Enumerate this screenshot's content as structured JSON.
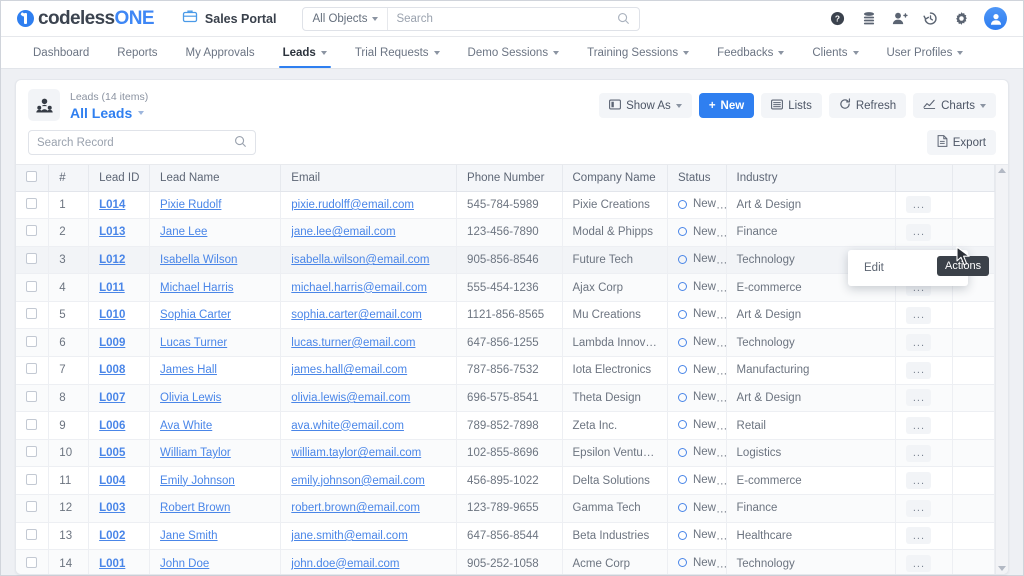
{
  "header": {
    "logo": {
      "part1": "codeless",
      "part2": "ONE",
      "icon": "codelessone-logo-icon"
    },
    "portal": {
      "label": "Sales Portal",
      "icon": "briefcase-icon"
    },
    "global_search": {
      "object_filter": "All Objects",
      "placeholder": "Search",
      "value": "",
      "icon": "search-icon"
    },
    "icons": [
      {
        "name": "help-icon",
        "glyph": "?"
      },
      {
        "name": "database-icon",
        "glyph": ""
      },
      {
        "name": "add-user-icon",
        "glyph": ""
      },
      {
        "name": "history-icon",
        "glyph": ""
      },
      {
        "name": "gear-icon",
        "glyph": ""
      },
      {
        "name": "user-avatar",
        "glyph": ""
      }
    ]
  },
  "nav": {
    "items": [
      {
        "label": "Dashboard",
        "has_caret": false,
        "active": false
      },
      {
        "label": "Reports",
        "has_caret": false,
        "active": false
      },
      {
        "label": "My Approvals",
        "has_caret": false,
        "active": false
      },
      {
        "label": "Leads",
        "has_caret": true,
        "active": true
      },
      {
        "label": "Trial Requests",
        "has_caret": true,
        "active": false
      },
      {
        "label": "Demo Sessions",
        "has_caret": true,
        "active": false
      },
      {
        "label": "Training Sessions",
        "has_caret": true,
        "active": false
      },
      {
        "label": "Feedbacks",
        "has_caret": true,
        "active": false
      },
      {
        "label": "Clients",
        "has_caret": true,
        "active": false
      },
      {
        "label": "User Profiles",
        "has_caret": true,
        "active": false
      }
    ]
  },
  "list_header": {
    "object_icon": "leads-person-icon",
    "subtitle": "Leads (14 items)",
    "title": "All Leads",
    "search_record": {
      "placeholder": "Search Record",
      "value": "",
      "icon": "search-icon"
    },
    "buttons": [
      {
        "label": "Show As",
        "icon": "layout-icon",
        "caret": true,
        "primary": false
      },
      {
        "label": "New",
        "icon": "plus-icon",
        "caret": false,
        "primary": true
      },
      {
        "label": "Lists",
        "icon": "list-icon",
        "caret": false,
        "primary": false
      },
      {
        "label": "Refresh",
        "icon": "refresh-icon",
        "caret": false,
        "primary": false
      },
      {
        "label": "Charts",
        "icon": "chart-icon",
        "caret": true,
        "primary": false
      }
    ],
    "export": {
      "label": "Export",
      "icon": "export-file-icon"
    }
  },
  "table": {
    "columns": [
      "",
      "#",
      "Lead ID",
      "Lead Name",
      "Email",
      "Phone Number",
      "Company Name",
      "Status",
      "Industry",
      "",
      ""
    ],
    "row_action_label": "...",
    "rows": [
      {
        "num": "1",
        "id": "L014",
        "name": "Pixie Rudolf",
        "email": "pixie.rudolff@email.com",
        "phone": "545-784-5989",
        "company": "Pixie Creations",
        "status": "New",
        "industry": "Art & Design"
      },
      {
        "num": "2",
        "id": "L013",
        "name": "Jane Lee",
        "email": "jane.lee@email.com",
        "phone": "123-456-7890",
        "company": "Modal & Phipps",
        "status": "New",
        "industry": "Finance"
      },
      {
        "num": "3",
        "id": "L012",
        "name": "Isabella Wilson",
        "email": "isabella.wilson@email.com",
        "phone": "905-856-8546",
        "company": "Future Tech",
        "status": "New",
        "industry": "Technology"
      },
      {
        "num": "4",
        "id": "L011",
        "name": "Michael Harris",
        "email": "michael.harris@email.com",
        "phone": "555-454-1236",
        "company": "Ajax Corp",
        "status": "New",
        "industry": "E-commerce"
      },
      {
        "num": "5",
        "id": "L010",
        "name": "Sophia Carter",
        "email": "sophia.carter@email.com",
        "phone": "1121-856-8565",
        "company": "Mu Creations",
        "status": "New",
        "industry": "Art & Design"
      },
      {
        "num": "6",
        "id": "L009",
        "name": "Lucas Turner",
        "email": "lucas.turner@email.com",
        "phone": "647-856-1255",
        "company": "Lambda Innovati…",
        "status": "New",
        "industry": "Technology"
      },
      {
        "num": "7",
        "id": "L008",
        "name": "James Hall",
        "email": "james.hall@email.com",
        "phone": "787-856-7532",
        "company": "Iota Electronics",
        "status": "New",
        "industry": "Manufacturing"
      },
      {
        "num": "8",
        "id": "L007",
        "name": "Olivia Lewis",
        "email": "olivia.lewis@email.com",
        "phone": "696-575-8541",
        "company": "Theta Design",
        "status": "New",
        "industry": "Art & Design"
      },
      {
        "num": "9",
        "id": "L006",
        "name": "Ava White",
        "email": "ava.white@email.com",
        "phone": "789-852-7898",
        "company": "Zeta Inc.",
        "status": "New",
        "industry": "Retail"
      },
      {
        "num": "10",
        "id": "L005",
        "name": "William Taylor",
        "email": "william.taylor@email.com",
        "phone": "102-855-8696",
        "company": "Epsilon Ventures",
        "status": "New",
        "industry": "Logistics"
      },
      {
        "num": "11",
        "id": "L004",
        "name": "Emily Johnson",
        "email": "emily.johnson@email.com",
        "phone": "456-895-1022",
        "company": "Delta Solutions",
        "status": "New",
        "industry": "E-commerce"
      },
      {
        "num": "12",
        "id": "L003",
        "name": "Robert Brown",
        "email": "robert.brown@email.com",
        "phone": "123-789-9655",
        "company": "Gamma Tech",
        "status": "New",
        "industry": "Finance"
      },
      {
        "num": "13",
        "id": "L002",
        "name": "Jane Smith",
        "email": "jane.smith@email.com",
        "phone": "647-856-8544",
        "company": "Beta Industries",
        "status": "New",
        "industry": "Healthcare"
      },
      {
        "num": "14",
        "id": "L001",
        "name": "John Doe",
        "email": "john.doe@email.com",
        "phone": "905-252-1058",
        "company": "Acme Corp",
        "status": "New",
        "industry": "Technology"
      }
    ],
    "hover_row_index": 2
  },
  "overlays": {
    "action_menu": {
      "items": [
        "Edit"
      ]
    },
    "tooltip": {
      "text": "Actions"
    }
  },
  "colors": {
    "accent": "#2f7ff0",
    "link": "#4a86e8",
    "header_bg": "#f4f6f9",
    "tooltip_bg": "#3b4149"
  }
}
